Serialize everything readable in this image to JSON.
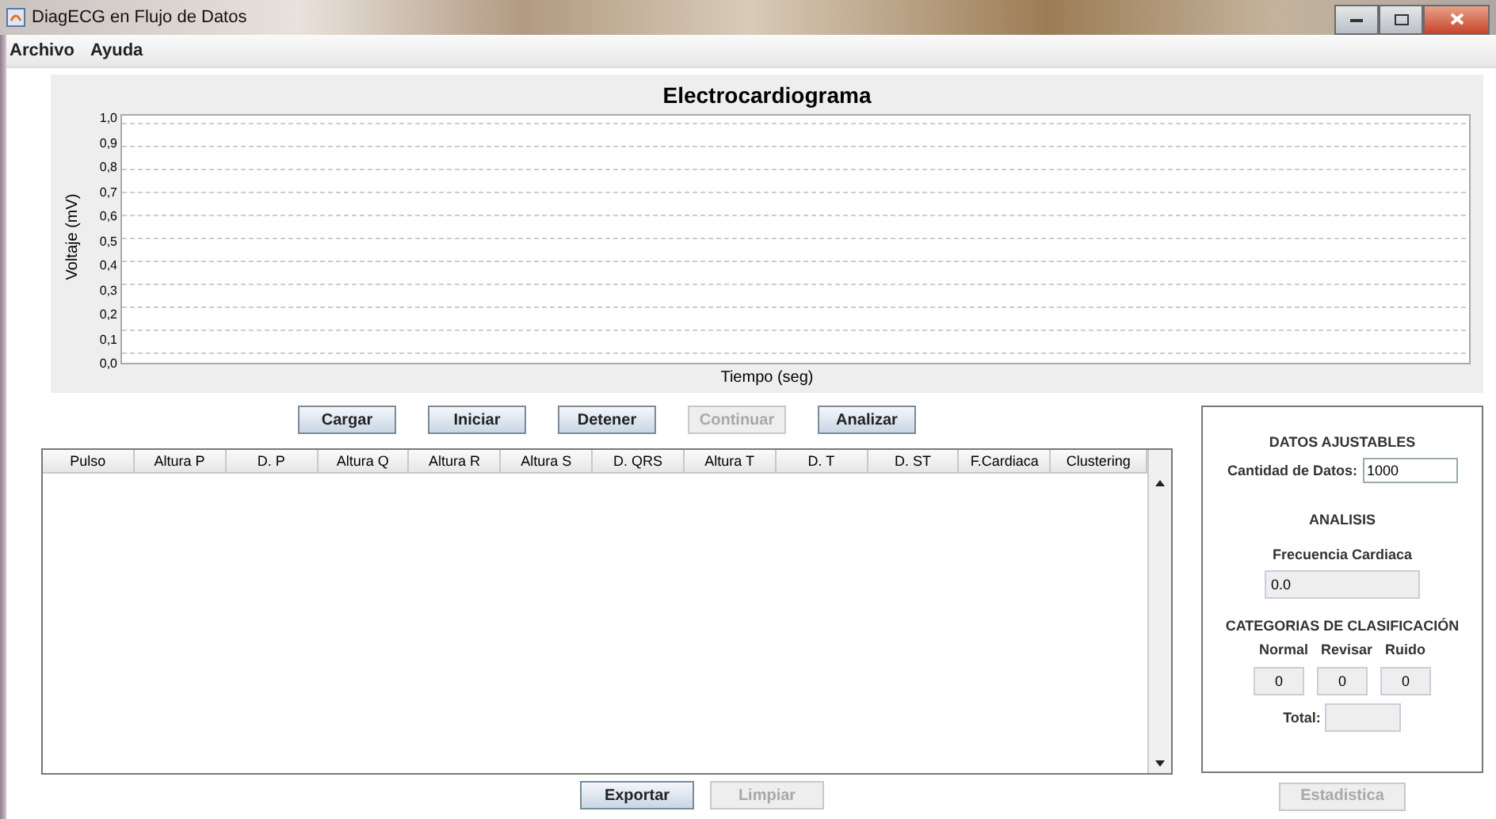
{
  "window": {
    "title": "DiagECG en Flujo de Datos"
  },
  "menu": [
    "Archivo",
    "Ayuda"
  ],
  "chart": {
    "title": "Electrocardiograma",
    "xlabel": "Tiempo (seg)",
    "ylabel": "Voltaje (mV)",
    "y_axis_labels": [
      "1,0",
      "0,9",
      "0,8",
      "0,7",
      "0,6",
      "0,5",
      "0,4",
      "0,3",
      "0,2",
      "0,1",
      "0,0"
    ]
  },
  "action_buttons": [
    {
      "label": "Cargar",
      "disabled": false
    },
    {
      "label": "Iniciar",
      "disabled": false
    },
    {
      "label": "Detener",
      "disabled": false
    },
    {
      "label": "Continuar",
      "disabled": true
    },
    {
      "label": "Analizar",
      "disabled": false
    }
  ],
  "table": {
    "columns": [
      "Pulso",
      "Altura P",
      "D. P",
      "Altura Q",
      "Altura R",
      "Altura S",
      "D. QRS",
      "Altura T",
      "D. T",
      "D. ST",
      "F.Cardiaca",
      "Clustering"
    ]
  },
  "bottom_buttons": [
    {
      "label": "Exportar",
      "disabled": false
    },
    {
      "label": "Limpiar",
      "disabled": true
    }
  ],
  "side_panel": {
    "adjustable_heading": "DATOS AJUSTABLES",
    "data_amount_label": "Cantidad de Datos:",
    "data_amount_value": "1000",
    "analysis_heading": "ANALISIS",
    "heart_rate_label": "Frecuencia Cardiaca",
    "heart_rate_value": "0.0",
    "categories_heading": "CATEGORIAS DE CLASIFICACIÓN",
    "categories": [
      {
        "label": "Normal",
        "value": "0"
      },
      {
        "label": "Revisar",
        "value": "0"
      },
      {
        "label": "Ruido",
        "value": "0"
      }
    ],
    "total_label": "Total:"
  },
  "stats_button": {
    "label": "Estadistica",
    "disabled": true
  }
}
